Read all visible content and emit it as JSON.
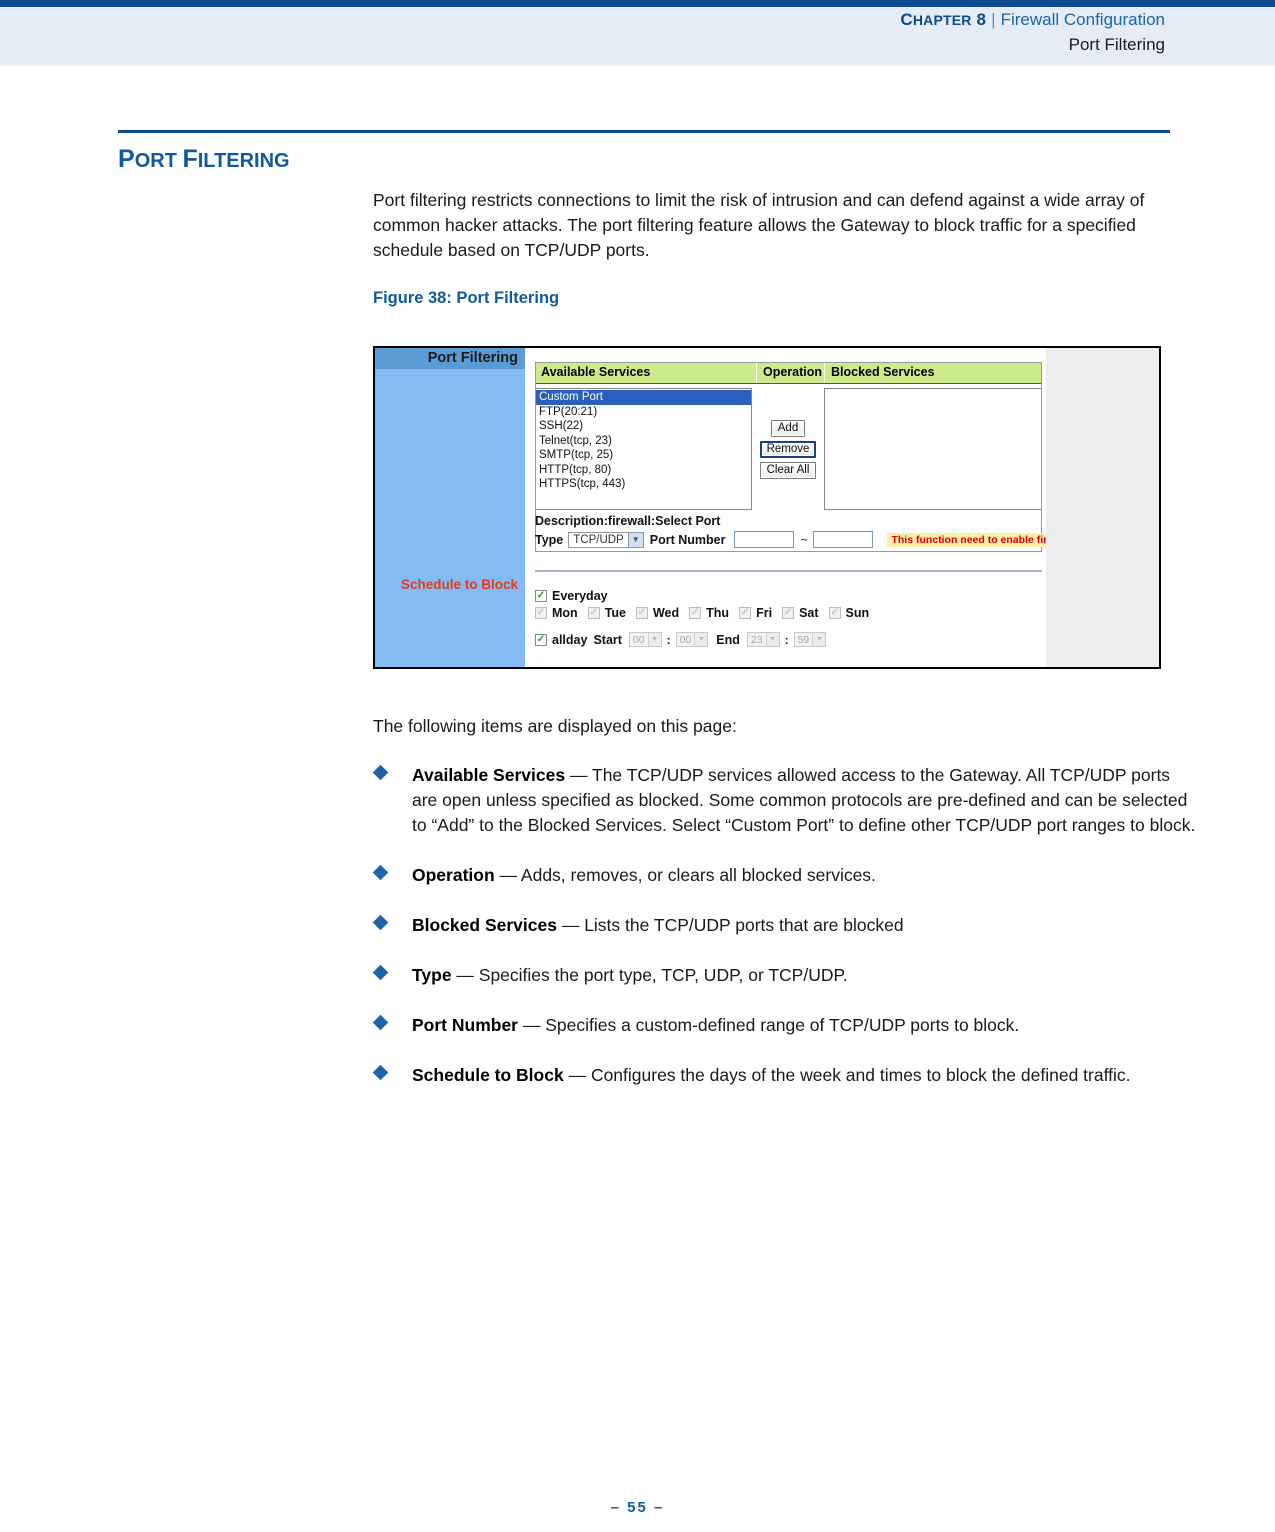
{
  "header": {
    "chapter_label": "CHAPTER 8",
    "chapter_cap": "C",
    "chapter_rest": "HAPTER",
    "chapter_number": " 8",
    "separator": "|",
    "chapter_title": "Firewall Configuration",
    "subtitle": "Port Filtering"
  },
  "section": {
    "title_cap": "P",
    "title_rest": "ORT ",
    "title_cap2": "F",
    "title_rest2": "ILTERING",
    "title_full": "PORT FILTERING"
  },
  "intro": {
    "paragraph": "Port filtering restricts connections to limit the risk of intrusion and can defend against a wide array of common hacker attacks. The port filtering feature allows the Gateway to block traffic for a specified schedule based on TCP/UDP ports."
  },
  "figure": {
    "caption": "Figure 38:  Port Filtering",
    "app": {
      "sidebar": {
        "header": "Port Filtering",
        "item": "Schedule to Block"
      },
      "columns": {
        "available": "Available Services",
        "operation": "Operation",
        "blocked": "Blocked Services"
      },
      "available_services": [
        "Custom Port",
        "FTP(20:21)",
        "SSH(22)",
        "Telnet(tcp, 23)",
        "SMTP(tcp, 25)",
        "HTTP(tcp, 80)",
        "HTTPS(tcp, 443)"
      ],
      "selected_service": "Custom Port",
      "blocked_services": [],
      "buttons": {
        "add": "Add",
        "remove": "Remove",
        "clear_all": "Clear All"
      },
      "description_line": "Description:firewall:Select Port",
      "type_label": "Type",
      "type_value": "TCP/UDP",
      "port_number_label": "Port Number",
      "port_start": "",
      "port_end": "",
      "range_separator": "~",
      "warning": "This function need to enable firewall first.",
      "schedule": {
        "everyday_label": "Everyday",
        "everyday_checked": true,
        "days": [
          {
            "label": "Mon",
            "checked": true
          },
          {
            "label": "Tue",
            "checked": true
          },
          {
            "label": "Wed",
            "checked": true
          },
          {
            "label": "Thu",
            "checked": true
          },
          {
            "label": "Fri",
            "checked": true
          },
          {
            "label": "Sat",
            "checked": true
          },
          {
            "label": "Sun",
            "checked": true
          }
        ],
        "allday_label": "allday",
        "allday_checked": true,
        "start_label": "Start",
        "start_hour": "00",
        "start_minute": "00",
        "end_label": "End",
        "end_hour": "23",
        "end_minute": "59",
        "colon": ":"
      }
    }
  },
  "lower": {
    "lead": "The following items are displayed on this page:",
    "bullets": [
      {
        "term": "Available Services",
        "dash": " — ",
        "text": "The TCP/UDP services allowed access to the Gateway. All TCP/UDP ports are open unless specified as blocked. Some common protocols are pre-defined and can be selected to “Add” to the Blocked Services. Select “Custom Port” to define other TCP/UDP port ranges to block."
      },
      {
        "term": "Operation",
        "dash": " — ",
        "text": "Adds, removes, or clears all blocked services."
      },
      {
        "term": "Blocked Services",
        "dash": " — ",
        "text": "Lists the TCP/UDP ports that are blocked"
      },
      {
        "term": "Type",
        "dash": " — ",
        "text": "Specifies the port type, TCP, UDP, or TCP/UDP."
      },
      {
        "term": "Port Number",
        "dash": " — ",
        "text": "Specifies a custom-defined range of TCP/UDP ports to block."
      },
      {
        "term": "Schedule to Block",
        "dash": " — ",
        "text": "Configures the days of the week and times to block the defined traffic."
      }
    ]
  },
  "footer": {
    "page_marker": "–  55  –"
  },
  "colors": {
    "header_band": "#e5ecf5",
    "rule_blue": "#0b4a8f",
    "accent_blue": "#125a9e",
    "sidebar_blue": "#85bbf5",
    "sidebar_header_blue": "#5b9bd5",
    "table_header_green": "#cdeb8b",
    "selected_row_blue": "#2a5fc0",
    "warning_bg": "#ffeeaa",
    "warning_fg": "#e00000",
    "sidebar_item_red": "#e03c1a"
  }
}
